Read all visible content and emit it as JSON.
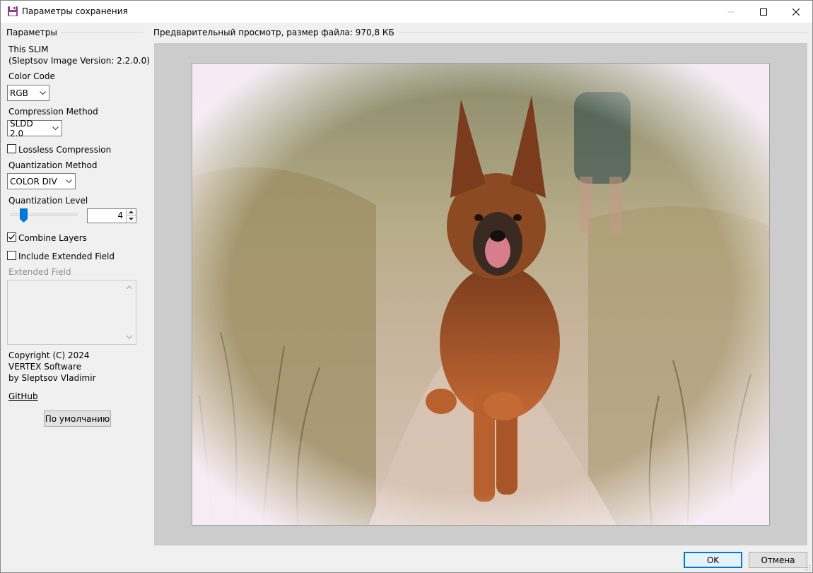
{
  "window": {
    "title": "Параметры сохранения",
    "icon": "floppy-disk-icon"
  },
  "params": {
    "group_title": "Параметры",
    "plugin_name": "This SLIM",
    "plugin_version": "(Sleptsov Image Version: 2.2.0.0)",
    "color_code_label": "Color Code",
    "color_code_value": "RGB",
    "compression_label": "Compression Method",
    "compression_value": "SLDD 2.0",
    "lossless_label": "Lossless Compression",
    "lossless_checked": false,
    "quant_method_label": "Quantization Method",
    "quant_method_value": "COLOR DIV",
    "quant_level_label": "Quantization Level",
    "quant_level_value": "4",
    "combine_layers_label": "Combine Layers",
    "combine_layers_checked": true,
    "include_ext_label": "Include Extended Field",
    "include_ext_checked": false,
    "ext_field_label": "Extended Field",
    "copyright_line1": "Copyright (C) 2024",
    "copyright_line2": "VERTEX Software",
    "copyright_line3": "by Sleptsov Vladimir",
    "github_link": "GitHub",
    "default_button": "По умолчанию"
  },
  "preview": {
    "group_title": "Предварительный просмотр, размер файла: 970,8 КБ"
  },
  "footer": {
    "ok_label": "OK",
    "cancel_label": "Отмена"
  },
  "colors": {
    "accent": "#0078d7",
    "preview_bg": "#cccccc",
    "window_bg": "#f0f0f0"
  }
}
